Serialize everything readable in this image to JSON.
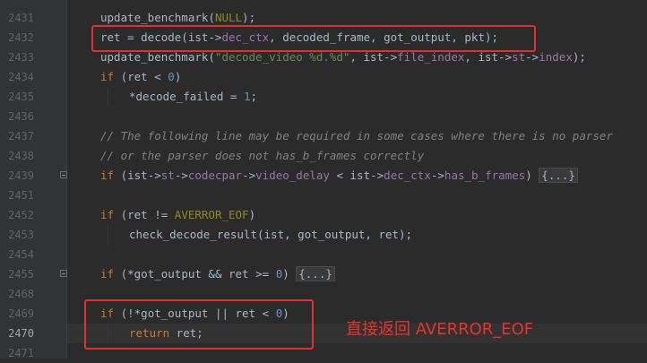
{
  "lines": [
    {
      "num": "2431",
      "indent": 0,
      "fold": false,
      "current": false,
      "tokens": [
        {
          "t": "update_benchmark(",
          "c": "plain"
        },
        {
          "t": "NULL",
          "c": "macro"
        },
        {
          "t": ");",
          "c": "plain"
        }
      ]
    },
    {
      "num": "2432",
      "indent": 0,
      "fold": false,
      "current": false,
      "tokens": [
        {
          "t": "ret = decode(ist->",
          "c": "plain"
        },
        {
          "t": "dec_ctx",
          "c": "field"
        },
        {
          "t": ", decoded_frame, got_output, pkt);",
          "c": "plain"
        }
      ]
    },
    {
      "num": "2433",
      "indent": 0,
      "fold": false,
      "current": false,
      "tokens": [
        {
          "t": "update_benchmark(",
          "c": "plain"
        },
        {
          "t": "\"decode_video %d.%d\"",
          "c": "str"
        },
        {
          "t": ", ist->",
          "c": "plain"
        },
        {
          "t": "file_index",
          "c": "field"
        },
        {
          "t": ", ist->",
          "c": "plain"
        },
        {
          "t": "st",
          "c": "field"
        },
        {
          "t": "->",
          "c": "plain"
        },
        {
          "t": "index",
          "c": "field"
        },
        {
          "t": ");",
          "c": "plain"
        }
      ]
    },
    {
      "num": "2434",
      "indent": 0,
      "fold": false,
      "current": false,
      "tokens": [
        {
          "t": "if",
          "c": "kw"
        },
        {
          "t": " (ret < ",
          "c": "plain"
        },
        {
          "t": "0",
          "c": "num"
        },
        {
          "t": ")",
          "c": "plain"
        }
      ]
    },
    {
      "num": "2435",
      "indent": 1,
      "fold": false,
      "current": false,
      "tokens": [
        {
          "t": "*decode_failed = ",
          "c": "plain"
        },
        {
          "t": "1",
          "c": "num"
        },
        {
          "t": ";",
          "c": "plain"
        }
      ]
    },
    {
      "num": "2436",
      "indent": 0,
      "fold": false,
      "current": false,
      "tokens": []
    },
    {
      "num": "2437",
      "indent": 0,
      "fold": false,
      "current": false,
      "tokens": [
        {
          "t": "// The following line may be required in some cases where there is no parser",
          "c": "cmt"
        }
      ]
    },
    {
      "num": "2438",
      "indent": 0,
      "fold": false,
      "current": false,
      "tokens": [
        {
          "t": "// or the parser does not has_b_frames correctly",
          "c": "cmt"
        }
      ]
    },
    {
      "num": "2439",
      "indent": 0,
      "fold": true,
      "current": false,
      "tokens": [
        {
          "t": "if",
          "c": "kw"
        },
        {
          "t": " (ist->",
          "c": "plain"
        },
        {
          "t": "st",
          "c": "field"
        },
        {
          "t": "->",
          "c": "plain"
        },
        {
          "t": "codecpar",
          "c": "field"
        },
        {
          "t": "->",
          "c": "plain"
        },
        {
          "t": "video_delay",
          "c": "field"
        },
        {
          "t": " < ist->",
          "c": "plain"
        },
        {
          "t": "dec_ctx",
          "c": "field"
        },
        {
          "t": "->",
          "c": "plain"
        },
        {
          "t": "has_b_frames",
          "c": "field"
        },
        {
          "t": ") ",
          "c": "plain"
        },
        {
          "t": "{...}",
          "c": "folded"
        }
      ]
    },
    {
      "num": "2451",
      "indent": 0,
      "fold": false,
      "current": false,
      "tokens": []
    },
    {
      "num": "2452",
      "indent": 0,
      "fold": false,
      "current": false,
      "tokens": [
        {
          "t": "if",
          "c": "kw"
        },
        {
          "t": " (ret != ",
          "c": "plain"
        },
        {
          "t": "AVERROR_EOF",
          "c": "macro"
        },
        {
          "t": ")",
          "c": "plain"
        }
      ]
    },
    {
      "num": "2453",
      "indent": 1,
      "fold": false,
      "current": false,
      "tokens": [
        {
          "t": "check_decode_result(ist, got_output, ret);",
          "c": "plain"
        }
      ]
    },
    {
      "num": "2454",
      "indent": 0,
      "fold": false,
      "current": false,
      "tokens": []
    },
    {
      "num": "2455",
      "indent": 0,
      "fold": true,
      "current": false,
      "tokens": [
        {
          "t": "if",
          "c": "kw"
        },
        {
          "t": " (*got_output && ret >= ",
          "c": "plain"
        },
        {
          "t": "0",
          "c": "num"
        },
        {
          "t": ") ",
          "c": "plain"
        },
        {
          "t": "{...}",
          "c": "folded"
        }
      ]
    },
    {
      "num": "2468",
      "indent": 0,
      "fold": false,
      "current": false,
      "tokens": []
    },
    {
      "num": "2469",
      "indent": 0,
      "fold": false,
      "current": false,
      "tokens": [
        {
          "t": "if",
          "c": "kw"
        },
        {
          "t": " (!*got_output || ret < ",
          "c": "plain"
        },
        {
          "t": "0",
          "c": "num"
        },
        {
          "t": ")",
          "c": "plain"
        }
      ]
    },
    {
      "num": "2470",
      "indent": 1,
      "fold": false,
      "current": true,
      "tokens": [
        {
          "t": "return",
          "c": "kw"
        },
        {
          "t": " ret;",
          "c": "plain"
        }
      ]
    },
    {
      "num": "2471",
      "indent": 0,
      "fold": false,
      "current": false,
      "tokens": []
    }
  ],
  "annotation": "直接返回 AVERROR_EOF",
  "colors": {
    "highlight_box": "#e03131",
    "annotation": "#e8322c"
  }
}
